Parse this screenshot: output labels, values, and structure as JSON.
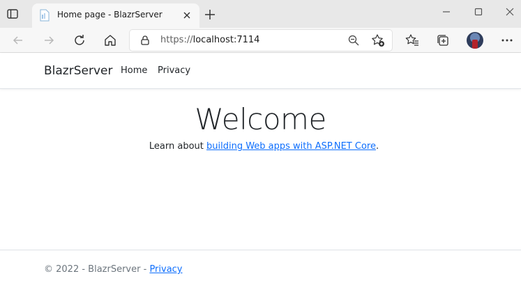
{
  "browser": {
    "tab": {
      "title": "Home page - BlazrServer"
    },
    "address": {
      "protocol": "https://",
      "host": "localhost:7114"
    },
    "icons": [
      "tab-actions-icon",
      "favicon",
      "close-icon",
      "plus-icon",
      "minimize-icon",
      "maximize-icon",
      "close-window-icon",
      "back-icon",
      "forward-icon",
      "refresh-icon",
      "home-icon",
      "lock-icon",
      "zoom-out-icon",
      "add-favorite-icon",
      "favorites-icon",
      "collections-icon",
      "profile-avatar",
      "more-icon"
    ]
  },
  "page": {
    "brand": "BlazrServer",
    "nav": {
      "home": "Home",
      "privacy": "Privacy"
    },
    "heading": "Welcome",
    "learn": {
      "prefix": "Learn about ",
      "link": "building Web apps with ASP.NET Core",
      "suffix": "."
    },
    "footer": {
      "text": "© 2022 - BlazrServer - ",
      "link": "Privacy"
    },
    "link_color": "#0d6efd"
  }
}
